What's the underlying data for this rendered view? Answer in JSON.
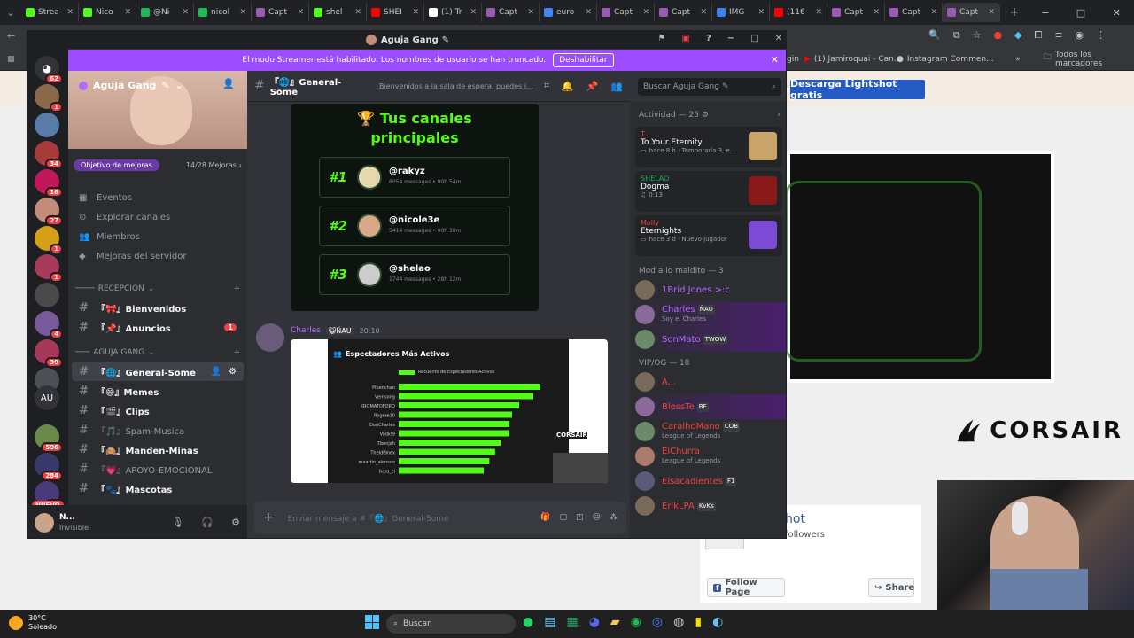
{
  "browser": {
    "tabs": [
      {
        "label": "Strea",
        "color": "#53fc18"
      },
      {
        "label": "Nico",
        "color": "#53fc18"
      },
      {
        "label": "@Ni",
        "color": "#1db954"
      },
      {
        "label": "nicol",
        "color": "#1db954"
      },
      {
        "label": "Capt",
        "color": "#9b59b6"
      },
      {
        "label": "shel",
        "color": "#53fc18"
      },
      {
        "label": "SHEI",
        "color": "#ff0000"
      },
      {
        "label": "(1) Tr",
        "color": "#ffffff"
      },
      {
        "label": "Capt",
        "color": "#9b59b6"
      },
      {
        "label": "euro",
        "color": "#4285f4"
      },
      {
        "label": "Capt",
        "color": "#9b59b6"
      },
      {
        "label": "Capt",
        "color": "#9b59b6"
      },
      {
        "label": "IMG",
        "color": "#3b82f6"
      },
      {
        "label": "(116",
        "color": "#ff0000"
      },
      {
        "label": "Capt",
        "color": "#9b59b6"
      },
      {
        "label": "Capt",
        "color": "#9b59b6"
      },
      {
        "label": "Capt",
        "color": "#9b59b6"
      }
    ],
    "bookmarks": {
      "item1": "gin",
      "item2": "(1) Jamiroquai - Can...",
      "item3": "Instagram Commen...",
      "all": "Todos los marcadores"
    }
  },
  "site": {
    "lightshot_button": "Descarga Lightshot gratis",
    "corsair": "CORSAIR",
    "fb_name": "hot",
    "fb_followers": "followers",
    "follow_page": "Follow Page",
    "share": "Share"
  },
  "discord": {
    "window_title": "Aguja Gang",
    "banner_text": "El modo Streamer está habilitado. Los nombres de usuario se han truncado.",
    "banner_button": "Deshabilitar",
    "server_name": "Aguja Gang",
    "boost_goal": "Objetivo de mejoras",
    "boost_count": "14/28 Mejoras",
    "nav": [
      "Eventos",
      "Explorar canales",
      "Miembros",
      "Mejoras del servidor"
    ],
    "category1": "RECEPCION",
    "category2": "AGUJA GANG",
    "channels_recepcion": [
      {
        "name": "『🎀』Bienvenidos",
        "badge": ""
      },
      {
        "name": "『📌』Anuncios",
        "badge": "1"
      }
    ],
    "channels_gang": [
      {
        "name": "General-Some"
      },
      {
        "name": "Memes"
      },
      {
        "name": "Clips"
      },
      {
        "name": "Spam-Musica"
      },
      {
        "name": "Manden-Minas"
      },
      {
        "name": "APOYO-EMOCIONAL"
      },
      {
        "name": "Mascotas"
      }
    ],
    "user_name": "N...",
    "user_status": "Invisible",
    "servers": [
      {
        "badge": "62"
      },
      {
        "badge": "1"
      },
      {
        "badge": ""
      },
      {
        "badge": "34"
      },
      {
        "badge": "16"
      },
      {
        "badge": "27"
      },
      {
        "badge": "1"
      },
      {
        "badge": "1"
      },
      {
        "badge": ""
      },
      {
        "badge": "4"
      },
      {
        "badge": "39"
      },
      {
        "badge": ""
      },
      {
        "badge": "596"
      },
      {
        "badge": "284"
      },
      {
        "badge": "54"
      }
    ],
    "server_au": "AU",
    "server_new": "NUEVO",
    "header": {
      "channel": "General-Some",
      "topic": "Bienvenidos a la sala de espera, puedes i...",
      "search": "Buscar Aguja Gang"
    },
    "top_channels": {
      "title_line1": "Tus canales",
      "title_line2": "principales",
      "entries": [
        {
          "rank": "#1",
          "name": "@rakyz",
          "stats": "6054 messages • 90h 54m"
        },
        {
          "rank": "#2",
          "name": "@nicole3e",
          "stats": "5414 messages • 90h 30m"
        },
        {
          "rank": "#3",
          "name": "@shelao",
          "stats": "1744 messages • 28h 12m"
        }
      ]
    },
    "message": {
      "author": "Charles",
      "tag": "ÑAU",
      "time": "20:10"
    },
    "embed_chart": {
      "title": "Espectadores Más Activos",
      "legend": "Recuento de Espectadores Activos",
      "watermark": "CORSAIR"
    },
    "chart_data": {
      "type": "bar",
      "categories": [
        "Pibenchan",
        "Vemsong",
        "KROMATOFORO",
        "Rogere10",
        "DonCharles",
        "Vodk!9",
        "7benjah",
        "TheIdl9nex",
        "maartin_alonsoo",
        "bass_cl"
      ],
      "values": [
        100,
        95,
        85,
        80,
        78,
        78,
        72,
        68,
        64,
        60
      ],
      "xlim": [
        0,
        100
      ]
    },
    "composer_placeholder": "Enviar mensaje a #『🌐』General-Some",
    "activity": {
      "header": "Actividad — 25",
      "items": [
        {
          "user": "T...",
          "user_color": "#f23f43",
          "game": "To Your Eternity",
          "meta": "hace 8 h · Temporada 3, e...",
          "thumb": "#c9a56a"
        },
        {
          "user": "SHELAO",
          "user_color": "#23a55a",
          "game": "Dogma",
          "meta": "0:13",
          "thumb": "#8a1a1a"
        },
        {
          "user": "Molly",
          "user_color": "#f23f43",
          "game": "Eternights",
          "meta": "hace 3 d · Nuevo jugador",
          "thumb": "#7b4bd6"
        }
      ]
    },
    "member_groups": [
      {
        "title": "Mod a lo maldito — 3",
        "members": [
          {
            "name": "1Brid Jones >:c",
            "color": "#b56bff",
            "tag": "",
            "sub": ""
          },
          {
            "name": "Charles",
            "color": "#b56bff",
            "tag": "ÑAU",
            "sub": "Soy el Charles"
          },
          {
            "name": "SonMato",
            "color": "#b56bff",
            "tag": "TWOW",
            "sub": ""
          }
        ]
      },
      {
        "title": "VIP/OG — 18",
        "members": [
          {
            "name": "A...",
            "color": "#f23f43",
            "tag": "",
            "sub": ""
          },
          {
            "name": "BlessTe",
            "color": "#f23f43",
            "tag": "BF",
            "sub": ""
          },
          {
            "name": "CaralhoMano",
            "color": "#f23f43",
            "tag": "COB",
            "sub": "League of Legends"
          },
          {
            "name": "ElChurra",
            "color": "#f23f43",
            "tag": "",
            "sub": "League of Legends"
          },
          {
            "name": "Elsacadientes",
            "color": "#f23f43",
            "tag": "F1",
            "sub": ""
          },
          {
            "name": "ErikLPA",
            "color": "#f23f43",
            "tag": "KvKs",
            "sub": ""
          }
        ]
      }
    ]
  },
  "taskbar": {
    "weather_temp": "30°C",
    "weather_text": "Soleado",
    "search": "Buscar"
  }
}
